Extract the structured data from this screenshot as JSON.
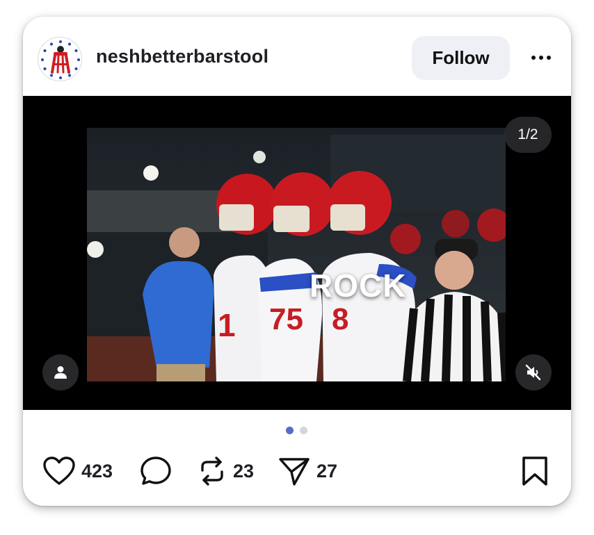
{
  "post": {
    "username": "neshbetterbarstool",
    "follow_label": "Follow",
    "media_counter": "1/2",
    "video_overlay_text": "ROCK",
    "carousel": {
      "current": 1,
      "total": 2
    }
  },
  "actions": {
    "likes": "423",
    "reposts": "23",
    "shares": "27"
  },
  "colors": {
    "accent_dot": "#5a6bc7",
    "inactive_dot": "#d3d6de",
    "follow_bg": "#eef0f5",
    "logo_red": "#d21c23",
    "logo_blue": "#2745a5"
  },
  "icons": [
    "barstool-logo-icon",
    "more-icon",
    "user-tag-icon",
    "muted-speaker-icon",
    "heart-icon",
    "comment-icon",
    "repost-icon",
    "share-icon",
    "bookmark-icon"
  ]
}
